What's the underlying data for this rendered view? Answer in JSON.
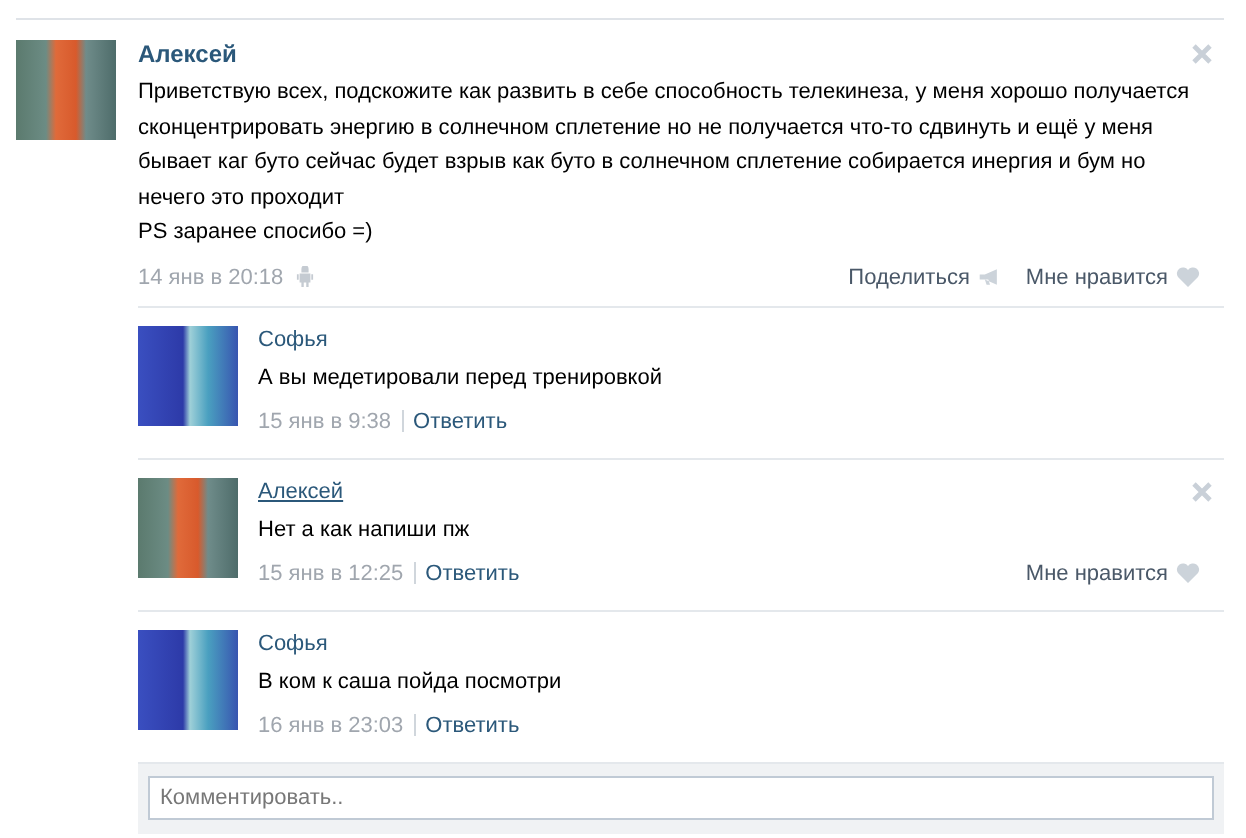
{
  "post": {
    "author": "Алексей",
    "paragraphs": [
      "Приветствую всех, подскожите как развить в себе способность телекинеза, у меня хорошо получается сконцентрировать энергию в солнечном сплетение но не получается что-то сдвинуть и ещё у меня бывает каг буто сейчас будет взрыв как буто в солнечном сплетение собирается инергия и бум но нечего это проходит",
      "PS заранее спосибо =)"
    ],
    "date": "14 янв в 20:18",
    "share": "Поделиться",
    "like": "Мне нравится"
  },
  "comments": [
    {
      "author": "Софья",
      "kind": "blue",
      "text": "А вы медетировали перед тренировкой",
      "date": "15 янв в 9:38",
      "reply": "Ответить",
      "hovered": false
    },
    {
      "author": "Алексей",
      "kind": "photo",
      "text": "Нет а как напиши пж",
      "date": "15 янв в 12:25",
      "reply": "Ответить",
      "hovered": true,
      "like": "Мне нравится"
    },
    {
      "author": "Софья",
      "kind": "blue",
      "text": "В ком к саша пойда посмотри",
      "date": "16 янв в 23:03",
      "reply": "Ответить",
      "hovered": false
    }
  ],
  "comment_box": {
    "placeholder": "Комментировать.."
  }
}
